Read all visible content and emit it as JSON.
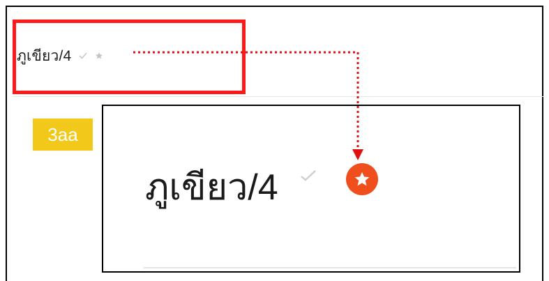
{
  "title": "ภูเขียว/4",
  "badge": "3aa",
  "zoom": {
    "title": "ภูเขียว/4"
  },
  "colors": {
    "highlight": "#ff1a1a",
    "badge_bg": "#f2c81a",
    "star_bg": "#f04e1c",
    "connector": "#e01010"
  },
  "icons": [
    "check-icon",
    "star-icon"
  ]
}
